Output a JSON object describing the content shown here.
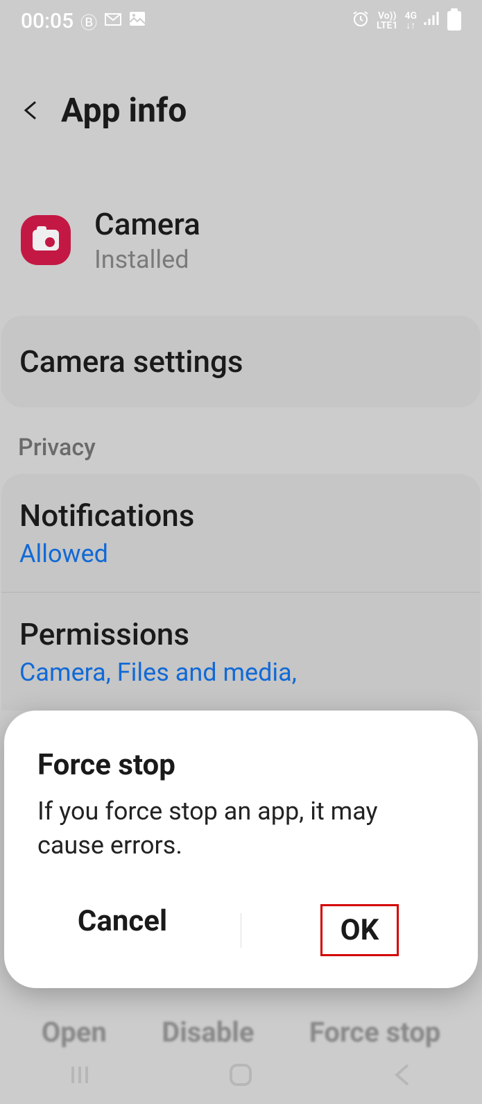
{
  "status_bar": {
    "time": "00:05",
    "icons_left": [
      "b-circle-icon",
      "gmail-icon",
      "gallery-icon"
    ],
    "icons_right": {
      "alarm": "alarm-icon",
      "volte_top": "Vo))",
      "volte_bottom": "LTE1",
      "net_top": "4G",
      "net_bottom": "↓↑",
      "signal": "signal-icon",
      "battery": "battery-icon"
    }
  },
  "header": {
    "title": "App info"
  },
  "app": {
    "name": "Camera",
    "status": "Installed"
  },
  "settings_link": {
    "label": "Camera settings"
  },
  "privacy": {
    "label": "Privacy",
    "notifications": {
      "title": "Notifications",
      "value": "Allowed"
    },
    "permissions": {
      "title": "Permissions",
      "value": "Camera, Files and media,"
    }
  },
  "bottom_actions": {
    "open": "Open",
    "disable": "Disable",
    "force_stop": "Force stop"
  },
  "dialog": {
    "title": "Force stop",
    "message": "If you force stop an app, it may cause errors.",
    "cancel": "Cancel",
    "ok": "OK"
  }
}
